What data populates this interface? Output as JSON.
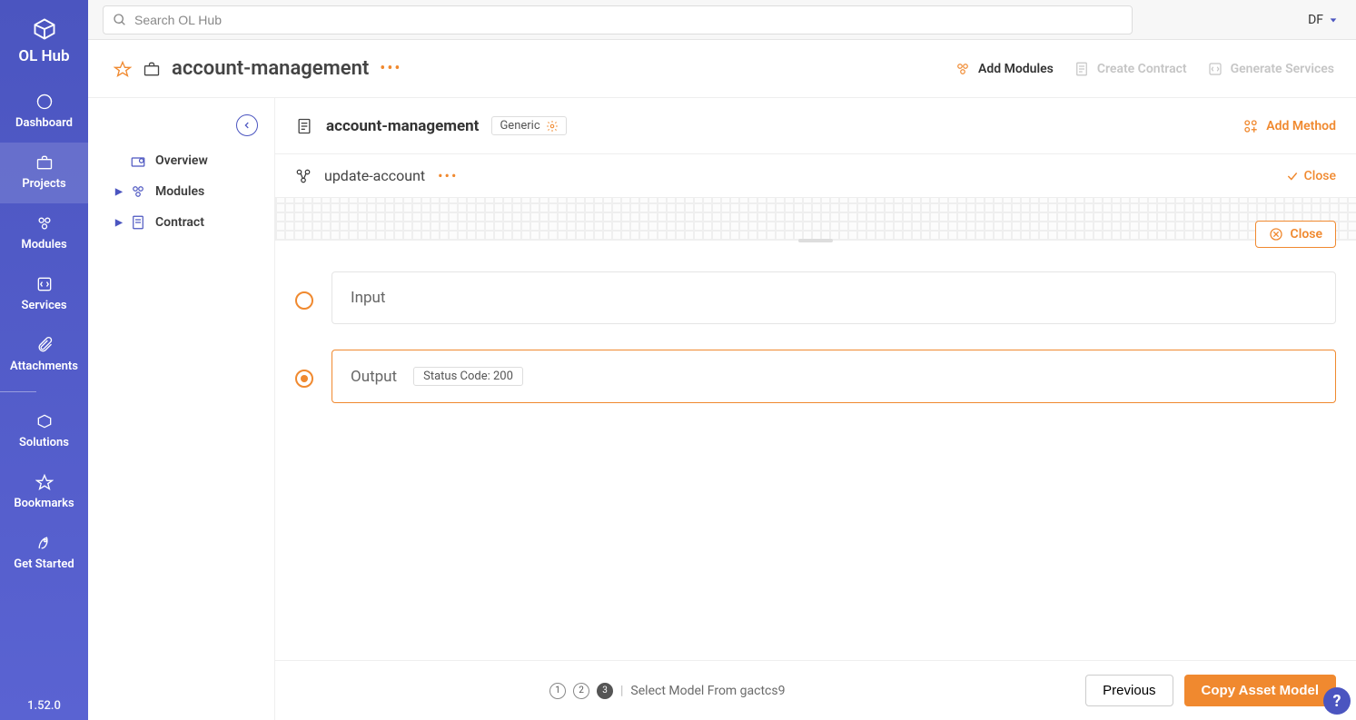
{
  "brand": {
    "name": "OL Hub",
    "version": "1.52.0"
  },
  "search": {
    "placeholder": "Search OL Hub"
  },
  "user": {
    "initials": "DF"
  },
  "sidebar": {
    "items": [
      {
        "label": "Dashboard"
      },
      {
        "label": "Projects"
      },
      {
        "label": "Modules"
      },
      {
        "label": "Services"
      },
      {
        "label": "Attachments"
      },
      {
        "label": "Solutions"
      },
      {
        "label": "Bookmarks"
      },
      {
        "label": "Get Started"
      }
    ]
  },
  "header": {
    "title": "account-management",
    "actions": {
      "add_modules": "Add Modules",
      "create_contract": "Create Contract",
      "generate_services": "Generate Services"
    }
  },
  "tree": {
    "overview": "Overview",
    "modules": "Modules",
    "contract": "Contract"
  },
  "module": {
    "name": "account-management",
    "chip": "Generic",
    "add_method": "Add Method"
  },
  "method": {
    "name": "update-account",
    "close": "Close"
  },
  "panel": {
    "close_button": "Close",
    "input_label": "Input",
    "output_label": "Output",
    "status_chip": "Status Code: 200"
  },
  "footer": {
    "step_label": "Select Model From gactcs9",
    "previous": "Previous",
    "copy_model": "Copy Asset Model"
  }
}
